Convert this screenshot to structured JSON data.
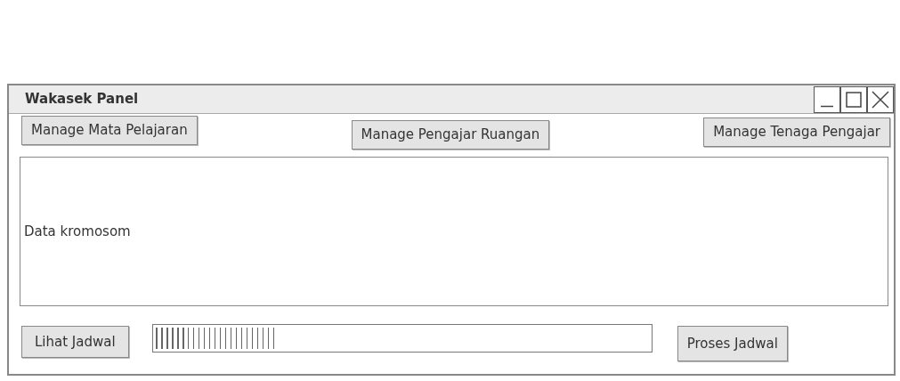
{
  "window": {
    "title": "Wakasek Panel"
  },
  "top_buttons": [
    "Manage Mata Pelajaran",
    "Manage Pengajar Ruangan",
    "Manage Tenaga Pengajar"
  ],
  "panel": {
    "text": "Data kromosom"
  },
  "bottom": {
    "left_button": "Lihat Jadwal",
    "progress": {
      "level": 0.24
    },
    "right_button": "Proses Jadwal"
  }
}
